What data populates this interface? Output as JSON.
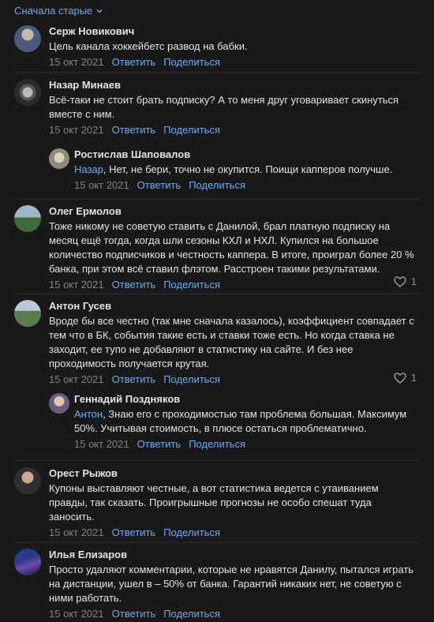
{
  "sort": {
    "label": "Сначала старые"
  },
  "actions": {
    "reply": "Ответить",
    "share": "Поделиться"
  },
  "colors": {
    "background": "#19191a",
    "link": "#71aaeb",
    "text": "#e1e3e6",
    "meta": "#828282"
  },
  "comments": [
    {
      "author": "Серж Новикович",
      "text": "Цель канала хоккейбетс развод на бабки.",
      "date": "15 окт 2021"
    },
    {
      "author": "Назар Минаев",
      "text": "Всё-таки не стоит брать подписку? А то меня друг уговаривает скинуться вместе с ним.",
      "date": "15 окт 2021"
    },
    {
      "author": "Ростислав Шаповалов",
      "mention": "Назар",
      "text": ", Нет, не бери, точно не окупится. Поищи капперов получше.",
      "date": "15 окт 2021"
    },
    {
      "author": "Олег Ермолов",
      "text": "Тоже никому не советую ставить с Данилой, брал платную подписку на месяц ещё тогда, когда шли сезоны КХЛ и НХЛ. Купился на большое количество подписчиков и честность каппера. В итоге, проиграл более 20 % банка, при этом всё ставил флэтом. Расстроен такими результатами.",
      "date": "15 окт 2021",
      "likes": "1"
    },
    {
      "author": "Антон Гусев",
      "text": "Вроде бы все честно (так мне сначала казалось), коэффициент совпадает с тем что в БК, события такие есть и ставки тоже есть. Но когда ставка не заходит, ее тупо не добавляют в статистику на сайте. И без нее проходимость получается крутая.",
      "date": "15 окт 2021",
      "likes": "1"
    },
    {
      "author": "Геннадий Поздняков",
      "mention": "Антон",
      "text": ", Знаю его с проходимостью там проблема большая. Максимум 50%. Учитывая стоимость, в плюсе остаться проблематично.",
      "date": "15 окт 2021"
    },
    {
      "author": "Орест Рыжов",
      "text": "Купоны выставляют честные, а вот статистика ведется с утаиванием правды, так сказать. Проигрышные прогнозы не особо спешат туда заносить.",
      "date": "15 окт 2021"
    },
    {
      "author": "Илья Елизаров",
      "text": "Просто удаляют комментарии, которые не нравятся Данилу, пытался играть на дистанции, ушел в – 50% от банка. Гарантий никаких нет, не советую с ними работать.",
      "date": "15 окт 2021"
    }
  ]
}
